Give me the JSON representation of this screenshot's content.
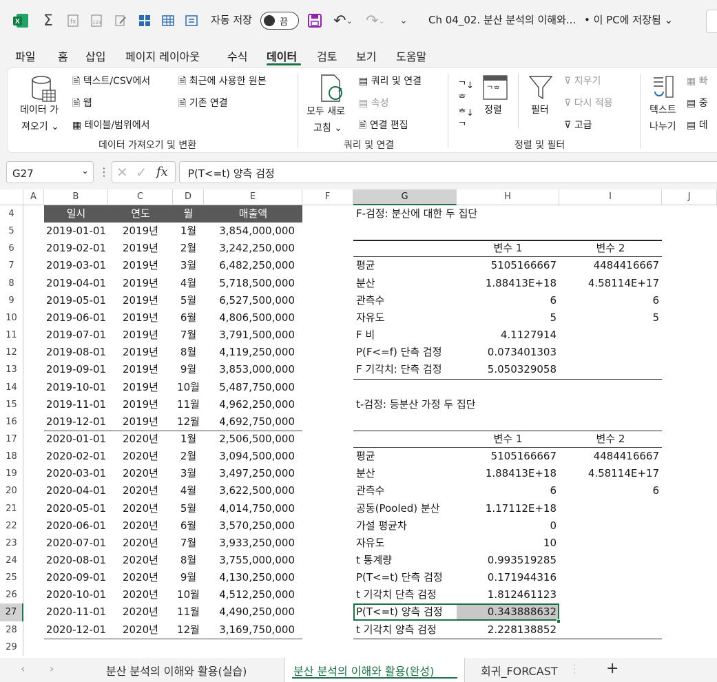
{
  "titlebar": {
    "autosave_label": "자동 저장",
    "autosave_state": "끔",
    "doc_title": "Ch 04_02. 분산 분석의 이해와...",
    "save_status": "• 이 PC에 저장됨 ⌄"
  },
  "menu": [
    "파일",
    "홈",
    "삽입",
    "페이지 레이아웃",
    "수식",
    "데이터",
    "검토",
    "보기",
    "도움말"
  ],
  "ribbon": {
    "get_data_line1": "데이터 가",
    "get_data_line2": "져오기 ⌄",
    "text_csv": "텍스트/CSV에서",
    "web": "웹",
    "table_range": "테이블/범위에서",
    "recent_sources": "최근에 사용한 원본",
    "existing_conn": "기존 연결",
    "group1": "데이터 가져오기 및 변환",
    "refresh_all_line1": "모두 새로",
    "refresh_all_line2": "고침 ⌄",
    "queries_conn": "쿼리 및 연결",
    "properties": "속성",
    "edit_links": "연결 편집",
    "group2": "쿼리 및 연결",
    "sort": "정렬",
    "filter": "필터",
    "clear": "지우기",
    "reapply": "다시 적용",
    "advanced": "고급",
    "group3": "정렬 및 필터",
    "text_to_cols_line1": "텍스트",
    "text_to_cols_line2": "나누기",
    "flash_fill": "빠",
    "remove_dup": "중",
    "data_val": "데"
  },
  "formula_bar": {
    "name_box": "G27",
    "formula": "P(T<=t) 양측 검정"
  },
  "columns": [
    "A",
    "B",
    "C",
    "D",
    "E",
    "F",
    "G",
    "H",
    "I",
    "J"
  ],
  "rows": [
    "4",
    "5",
    "6",
    "7",
    "8",
    "9",
    "10",
    "11",
    "12",
    "13",
    "14",
    "15",
    "16",
    "17",
    "18",
    "19",
    "20",
    "21",
    "22",
    "23",
    "24",
    "25",
    "26",
    "27",
    "28",
    "29"
  ],
  "table": {
    "headers": [
      "일시",
      "연도",
      "월",
      "매출액"
    ],
    "rows": [
      [
        "2019-01-01",
        "2019년",
        "1월",
        "3,854,000,000"
      ],
      [
        "2019-02-01",
        "2019년",
        "2월",
        "3,242,250,000"
      ],
      [
        "2019-03-01",
        "2019년",
        "3월",
        "6,482,250,000"
      ],
      [
        "2019-04-01",
        "2019년",
        "4월",
        "5,718,500,000"
      ],
      [
        "2019-05-01",
        "2019년",
        "5월",
        "6,527,500,000"
      ],
      [
        "2019-06-01",
        "2019년",
        "6월",
        "4,806,500,000"
      ],
      [
        "2019-07-01",
        "2019년",
        "7월",
        "3,791,500,000"
      ],
      [
        "2019-08-01",
        "2019년",
        "8월",
        "4,119,250,000"
      ],
      [
        "2019-09-01",
        "2019년",
        "9월",
        "3,853,000,000"
      ],
      [
        "2019-10-01",
        "2019년",
        "10월",
        "5,487,750,000"
      ],
      [
        "2019-11-01",
        "2019년",
        "11월",
        "4,962,250,000"
      ],
      [
        "2019-12-01",
        "2019년",
        "12월",
        "4,692,750,000"
      ],
      [
        "2020-01-01",
        "2020년",
        "1월",
        "2,506,500,000"
      ],
      [
        "2020-02-01",
        "2020년",
        "2월",
        "3,094,500,000"
      ],
      [
        "2020-03-01",
        "2020년",
        "3월",
        "3,497,250,000"
      ],
      [
        "2020-04-01",
        "2020년",
        "4월",
        "3,622,500,000"
      ],
      [
        "2020-05-01",
        "2020년",
        "5월",
        "4,014,750,000"
      ],
      [
        "2020-06-01",
        "2020년",
        "6월",
        "3,570,250,000"
      ],
      [
        "2020-07-01",
        "2020년",
        "7월",
        "3,933,250,000"
      ],
      [
        "2020-08-01",
        "2020년",
        "8월",
        "3,755,000,000"
      ],
      [
        "2020-09-01",
        "2020년",
        "9월",
        "4,130,250,000"
      ],
      [
        "2020-10-01",
        "2020년",
        "10월",
        "4,512,250,000"
      ],
      [
        "2020-11-01",
        "2020년",
        "11월",
        "4,490,250,000"
      ],
      [
        "2020-12-01",
        "2020년",
        "12월",
        "3,169,750,000"
      ]
    ]
  },
  "ftest": {
    "title": "F-검정: 분산에 대한 두 집단",
    "var1": "변수 1",
    "var2": "변수 2",
    "rows": [
      [
        "평균",
        "5105166667",
        "4484416667"
      ],
      [
        "분산",
        "1.88413E+18",
        "4.58114E+17"
      ],
      [
        "관측수",
        "6",
        "6"
      ],
      [
        "자유도",
        "5",
        "5"
      ],
      [
        "F 비",
        "4.1127914",
        ""
      ],
      [
        "P(F<=f) 단측 검정",
        "0.073401303",
        ""
      ],
      [
        "F 기각치: 단측 검정",
        "5.050329058",
        ""
      ]
    ]
  },
  "ttest": {
    "title": "t-검정: 등분산 가정 두 집단",
    "var1": "변수 1",
    "var2": "변수 2",
    "rows": [
      [
        "평균",
        "5105166667",
        "4484416667"
      ],
      [
        "분산",
        "1.88413E+18",
        "4.58114E+17"
      ],
      [
        "관측수",
        "6",
        "6"
      ],
      [
        "공동(Pooled) 분산",
        "1.17112E+18",
        ""
      ],
      [
        "가설 평균차",
        "0",
        ""
      ],
      [
        "자유도",
        "10",
        ""
      ],
      [
        "t 통계량",
        "0.993519285",
        ""
      ],
      [
        "P(T<=t) 단측 검정",
        "0.171944316",
        ""
      ],
      [
        "t 기각치 단측 검정",
        "1.812461123",
        ""
      ],
      [
        "P(T<=t) 양측 검정",
        "0.343888632",
        ""
      ],
      [
        "t 기각치 양측 검정",
        "2.228138852",
        ""
      ]
    ]
  },
  "sheet_tabs": [
    "분산 분석의 이해와 활용(실습)",
    "분산 분석의 이해와 활용(완성)",
    "회귀_FORCAST"
  ],
  "colors": {
    "accent": "#1e7145",
    "header_fill": "#595959"
  }
}
